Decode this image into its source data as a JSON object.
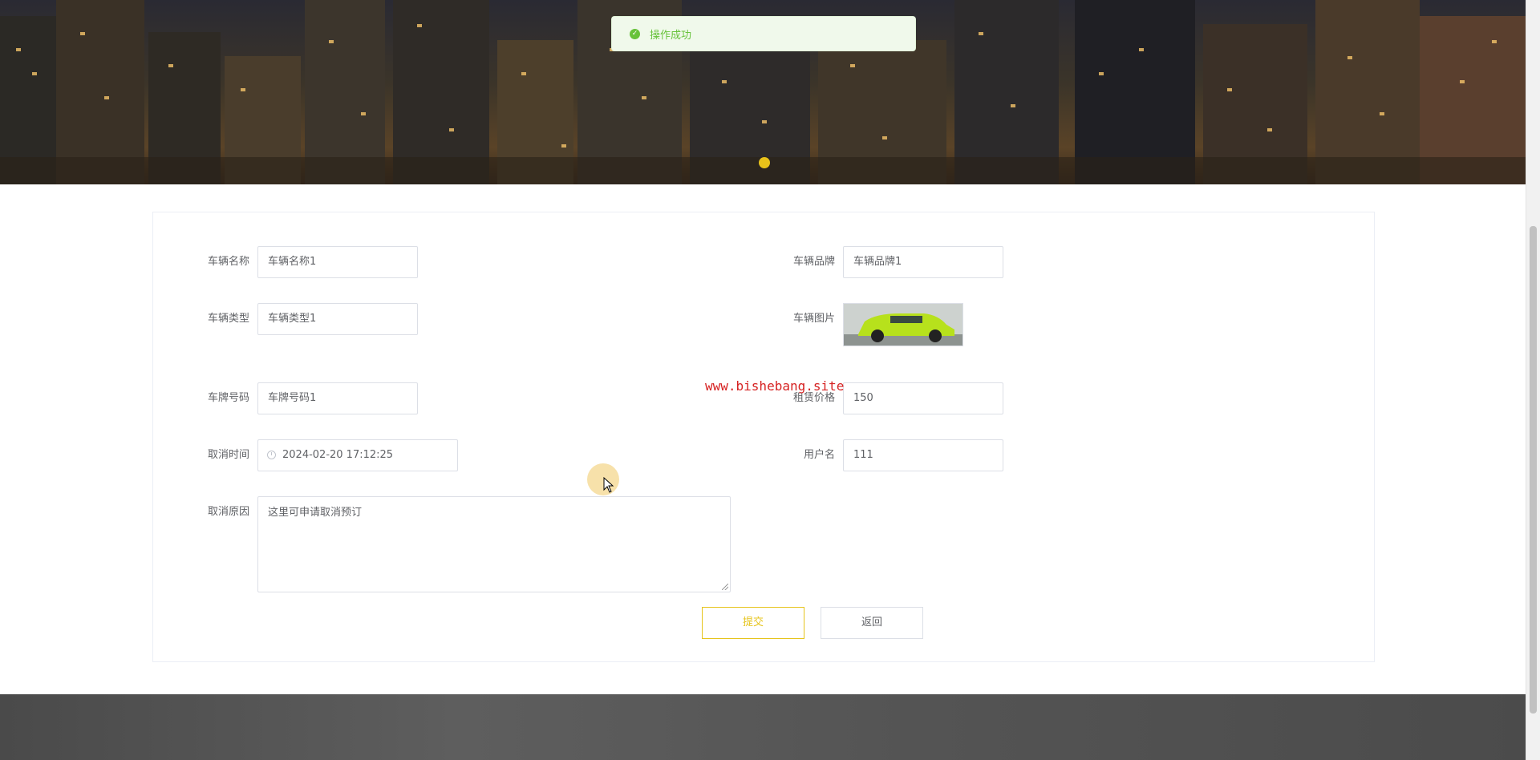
{
  "toast": {
    "message": "操作成功",
    "icon": "success-check-icon",
    "color": "#67c23a"
  },
  "form": {
    "vehicle_name": {
      "label": "车辆名称",
      "value": "车辆名称1"
    },
    "vehicle_brand": {
      "label": "车辆品牌",
      "value": "车辆品牌1"
    },
    "vehicle_type": {
      "label": "车辆类型",
      "value": "车辆类型1"
    },
    "vehicle_image": {
      "label": "车辆图片"
    },
    "plate_number": {
      "label": "车牌号码",
      "value": "车牌号码1"
    },
    "rental_price": {
      "label": "租赁价格",
      "value": "150"
    },
    "cancel_time": {
      "label": "取消时间",
      "value": "2024-02-20 17:12:25"
    },
    "username": {
      "label": "用户名",
      "value": "111"
    },
    "cancel_reason": {
      "label": "取消原因",
      "value": "这里可申请取消预订"
    }
  },
  "buttons": {
    "submit": "提交",
    "back": "返回"
  },
  "watermark": "www.bishebang.site",
  "colors": {
    "accent": "#e6c41c",
    "success": "#67c23a",
    "watermark": "#d62222"
  }
}
